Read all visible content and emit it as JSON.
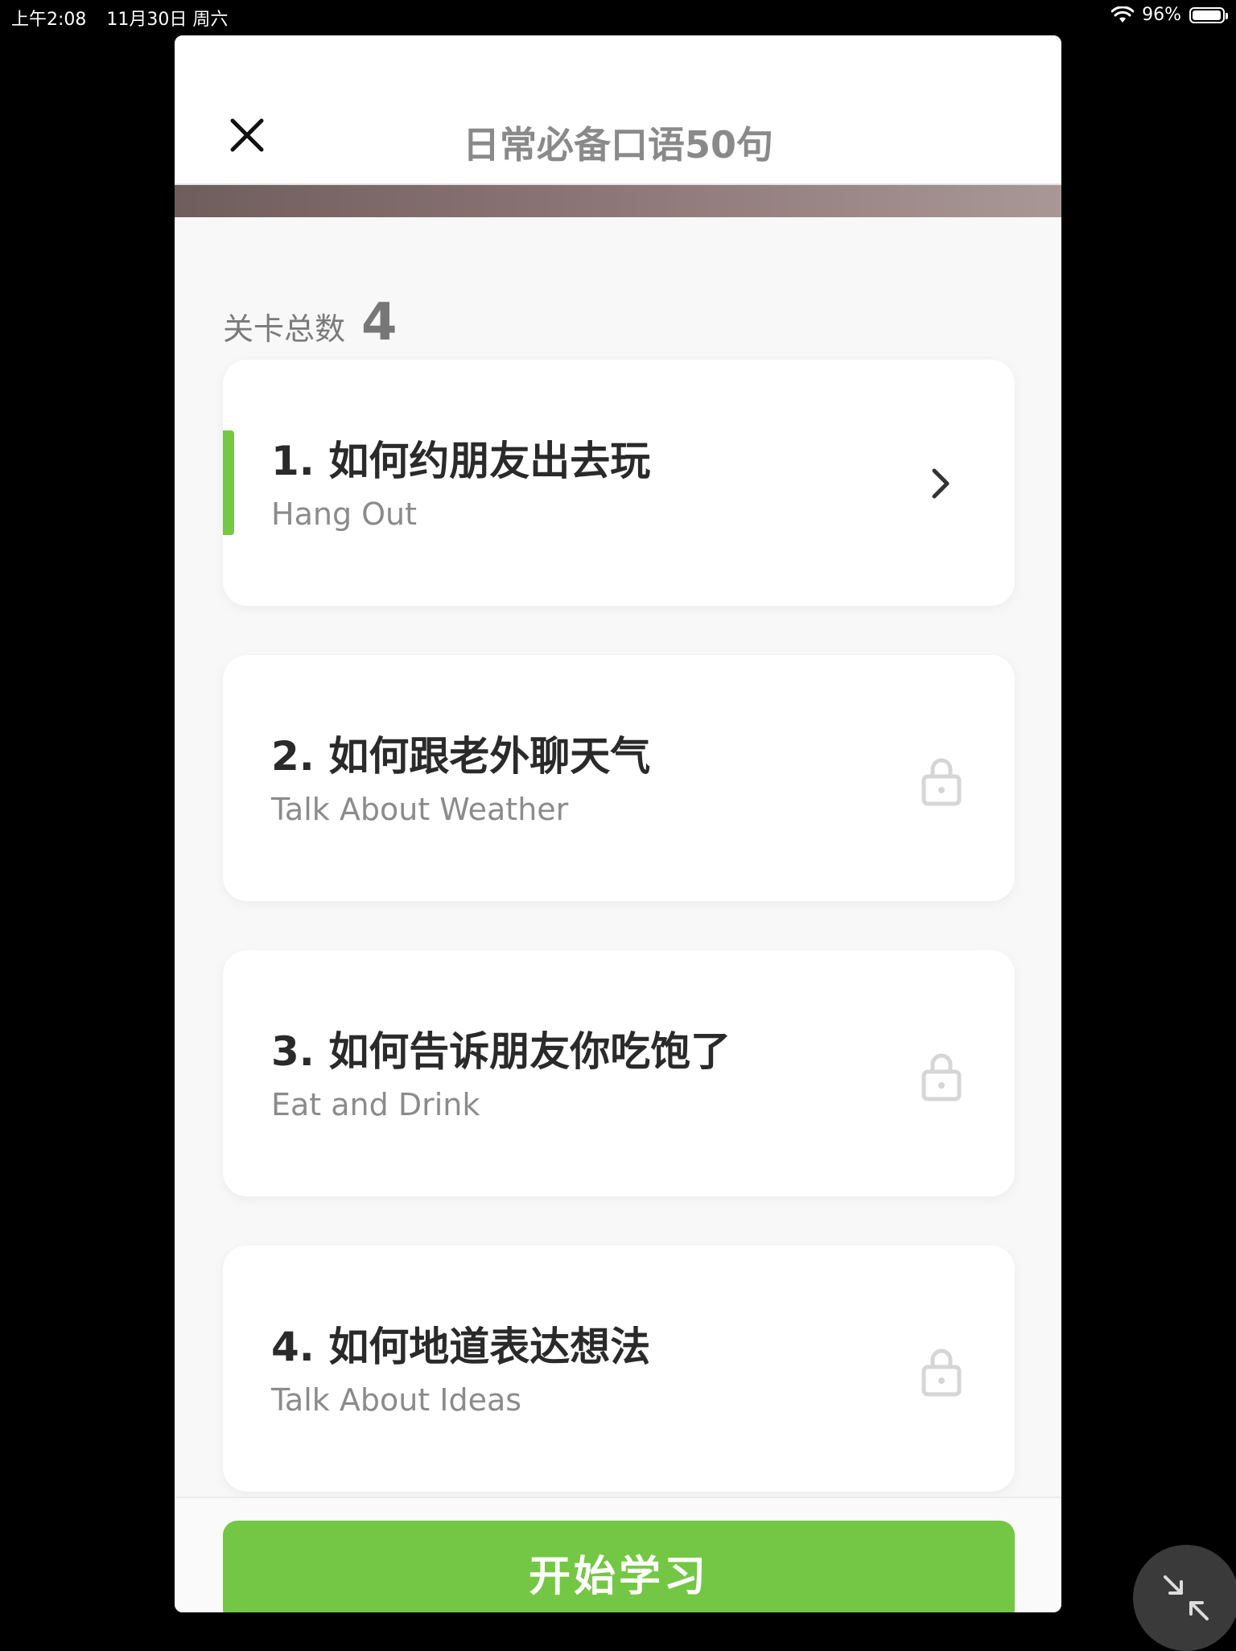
{
  "status_bar": {
    "time": "上午2:08",
    "date": "11月30日 周六",
    "battery_percent": "96%",
    "battery_level": 0.96
  },
  "modal": {
    "title": "日常必备口语50句",
    "count_label": "关卡总数",
    "count_value": "4"
  },
  "lessons": [
    {
      "title": "1. 如何约朋友出去玩",
      "subtitle": "Hang Out",
      "state": "active"
    },
    {
      "title": "2. 如何跟老外聊天气",
      "subtitle": "Talk About Weather",
      "state": "locked"
    },
    {
      "title": "3. 如何告诉朋友你吃饱了",
      "subtitle": "Eat and Drink",
      "state": "locked"
    },
    {
      "title": "4. 如何地道表达想法",
      "subtitle": "Talk About Ideas",
      "state": "locked"
    }
  ],
  "footer": {
    "start_label": "开始学习"
  },
  "icons": {
    "close": "close-icon",
    "chevron": "chevron-right-icon",
    "lock": "lock-icon",
    "minimize": "minimize-icon",
    "wifi": "wifi-icon",
    "battery": "battery-icon"
  },
  "colors": {
    "accent_green": "#74c744",
    "title_gray": "#8a8a8a",
    "lock_gray": "#d6d6d6"
  }
}
